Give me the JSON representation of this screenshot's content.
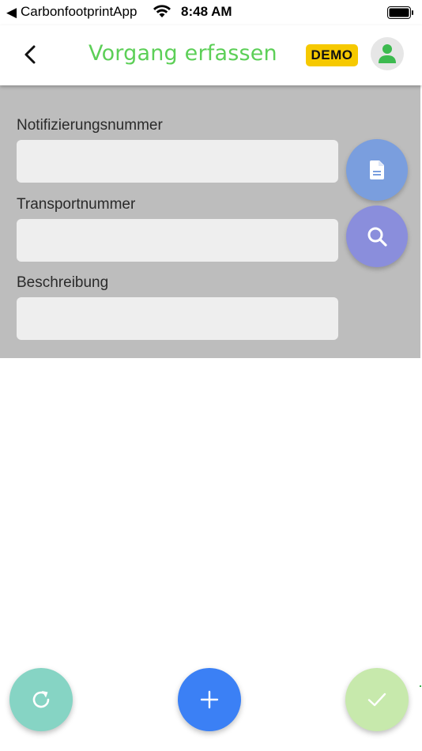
{
  "status_bar": {
    "back_arrow": "◀",
    "carrier": "CarbonfootprintApp",
    "time": "8:48 AM",
    "icons": [
      "wifi-icon",
      "battery-icon"
    ]
  },
  "header": {
    "title": "Vorgang erfassen",
    "badge": "DEMO",
    "back_icon": "chevron-left-icon",
    "avatar_icon": "user-icon"
  },
  "form": {
    "fields": [
      {
        "label": "Notifizierungsnummer",
        "value": "",
        "placeholder": ""
      },
      {
        "label": "Transportnummer",
        "value": "",
        "placeholder": ""
      },
      {
        "label": "Beschreibung",
        "value": "",
        "placeholder": ""
      }
    ],
    "side_actions": [
      "document-icon",
      "search-icon"
    ]
  },
  "bottom_actions": [
    "refresh-icon",
    "plus-icon",
    "check-icon"
  ],
  "colors": {
    "title": "#5ccf57",
    "badge": "#f6c900",
    "overlay": "#bdbdbd",
    "input_bg": "#eeeeee",
    "fab_document": "#7a9ede",
    "fab_search": "#8a8edc",
    "fab_refresh": "#86d4c4",
    "fab_add": "#3b80f5",
    "fab_confirm": "#c7e9ac"
  }
}
